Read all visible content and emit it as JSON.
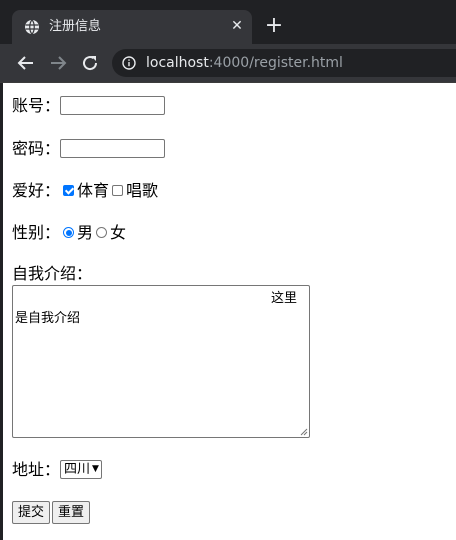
{
  "browser": {
    "tab_title": "注册信息",
    "tab_close": "✕",
    "new_tab": "+",
    "url_host": "localhost",
    "url_rest": ":4000/register.html"
  },
  "form": {
    "account_label": "账号：",
    "account_value": "",
    "password_label": "密码：",
    "password_value": "",
    "hobby_label": "爱好：",
    "hobbies": [
      {
        "label": "体育",
        "checked": true
      },
      {
        "label": "唱歌",
        "checked": false
      }
    ],
    "gender_label": "性别：",
    "genders": [
      {
        "label": "男",
        "checked": true
      },
      {
        "label": "女",
        "checked": false
      }
    ],
    "intro_label": "自我介绍：",
    "intro_line1": "这里",
    "intro_line2": "是自我介绍",
    "address_label": "地址：",
    "address_selected": "四川",
    "submit_label": "提交",
    "reset_label": "重置"
  },
  "colors": {
    "accent": "#0075ff",
    "chrome_dark": "#202124",
    "chrome_toolbar": "#35363a"
  }
}
